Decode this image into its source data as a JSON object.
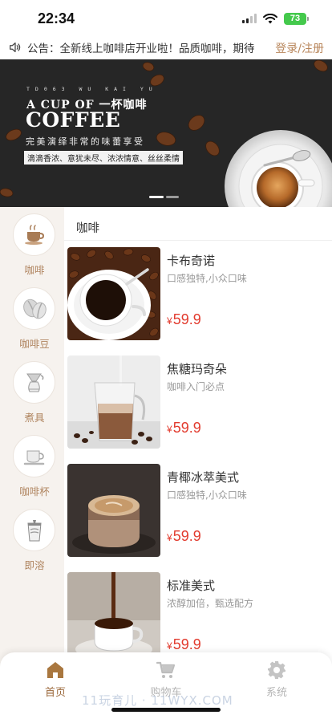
{
  "status_bar": {
    "time": "22:34",
    "battery": "73"
  },
  "notice": {
    "text": "公告：全新线上咖啡店开业啦！品质咖啡，期待",
    "login": "登录/注册"
  },
  "banner": {
    "subtitle": "TD063 WU KAI YU",
    "line1": "A CUP OF  一杯咖啡",
    "coffee": "COFFEE",
    "tagline": "完美演绎非常的味蕾享受",
    "desc": "滴滴香浓、意犹未尽、浓浓情意、丝丝柔情"
  },
  "categories": [
    {
      "label": "咖啡",
      "icon": "coffee-cup-icon"
    },
    {
      "label": "咖啡豆",
      "icon": "coffee-beans-icon"
    },
    {
      "label": "煮具",
      "icon": "brewer-icon"
    },
    {
      "label": "咖啡杯",
      "icon": "cup-icon"
    },
    {
      "label": "即溶",
      "icon": "instant-coffee-icon"
    }
  ],
  "section_title": "咖啡",
  "products": [
    {
      "name": "卡布奇诺",
      "desc": "口感独特,小众口味",
      "currency": "¥",
      "price": "59.9"
    },
    {
      "name": "焦糖玛奇朵",
      "desc": "咖啡入门必点",
      "currency": "¥",
      "price": "59.9"
    },
    {
      "name": "青椰冰萃美式",
      "desc": "口感独特,小众口味",
      "currency": "¥",
      "price": "59.9"
    },
    {
      "name": "标准美式",
      "desc": "浓醇加倍，甄选配方",
      "currency": "¥",
      "price": "59.9"
    }
  ],
  "tabs": [
    {
      "label": "首页",
      "icon": "home-icon"
    },
    {
      "label": "购物车",
      "icon": "cart-icon"
    },
    {
      "label": "系统",
      "icon": "gear-icon"
    }
  ],
  "watermark": "11玩育儿 · 11WYX.COM",
  "colors": {
    "accent": "#9c6a3d",
    "price": "#e23b2e",
    "sidebar": "#f6f2ee"
  }
}
